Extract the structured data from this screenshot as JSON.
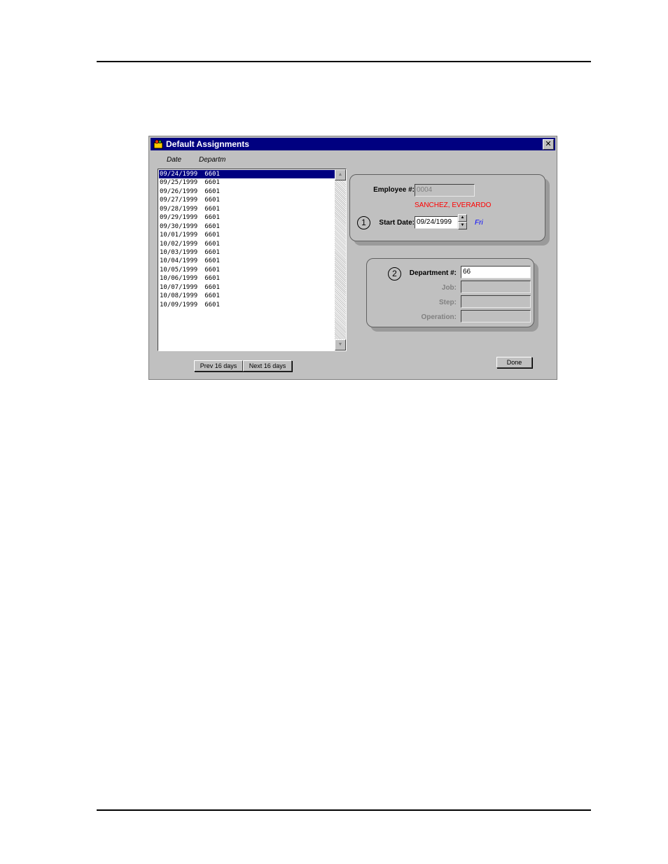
{
  "window": {
    "title": "Default Assignments",
    "close_glyph": "✕"
  },
  "list": {
    "col_date": "Date",
    "col_dept": "Departm",
    "rows": [
      {
        "date": "09/24/1999",
        "dept": "6601"
      },
      {
        "date": "09/25/1999",
        "dept": "6601"
      },
      {
        "date": "09/26/1999",
        "dept": "6601"
      },
      {
        "date": "09/27/1999",
        "dept": "6601"
      },
      {
        "date": "09/28/1999",
        "dept": "6601"
      },
      {
        "date": "09/29/1999",
        "dept": "6601"
      },
      {
        "date": "09/30/1999",
        "dept": "6601"
      },
      {
        "date": "10/01/1999",
        "dept": "6601"
      },
      {
        "date": "10/02/1999",
        "dept": "6601"
      },
      {
        "date": "10/03/1999",
        "dept": "6601"
      },
      {
        "date": "10/04/1999",
        "dept": "6601"
      },
      {
        "date": "10/05/1999",
        "dept": "6601"
      },
      {
        "date": "10/06/1999",
        "dept": "6601"
      },
      {
        "date": "10/07/1999",
        "dept": "6601"
      },
      {
        "date": "10/08/1999",
        "dept": "6601"
      },
      {
        "date": "10/09/1999",
        "dept": "6601"
      }
    ],
    "selected_index": 0
  },
  "buttons": {
    "prev": "Prev 16 days",
    "next": "Next 16 days",
    "done": "Done"
  },
  "employee": {
    "label": "Employee #:",
    "value": "0004",
    "name": "SANCHEZ, EVERARDO",
    "step_number": "1",
    "start_date_label": "Start Date:",
    "start_date": "09/24/1999",
    "day": "Fri"
  },
  "assignment": {
    "step_number": "2",
    "department_label": "Department #:",
    "department_value": "66",
    "job_label": "Job:",
    "job_value": "",
    "step_label": "Step:",
    "step_value": "",
    "operation_label": "Operation:",
    "operation_value": ""
  },
  "colors": {
    "titlebar": "#000080",
    "selection": "#000080",
    "employee_name": "#ff0000",
    "day_name": "#0000ff"
  }
}
